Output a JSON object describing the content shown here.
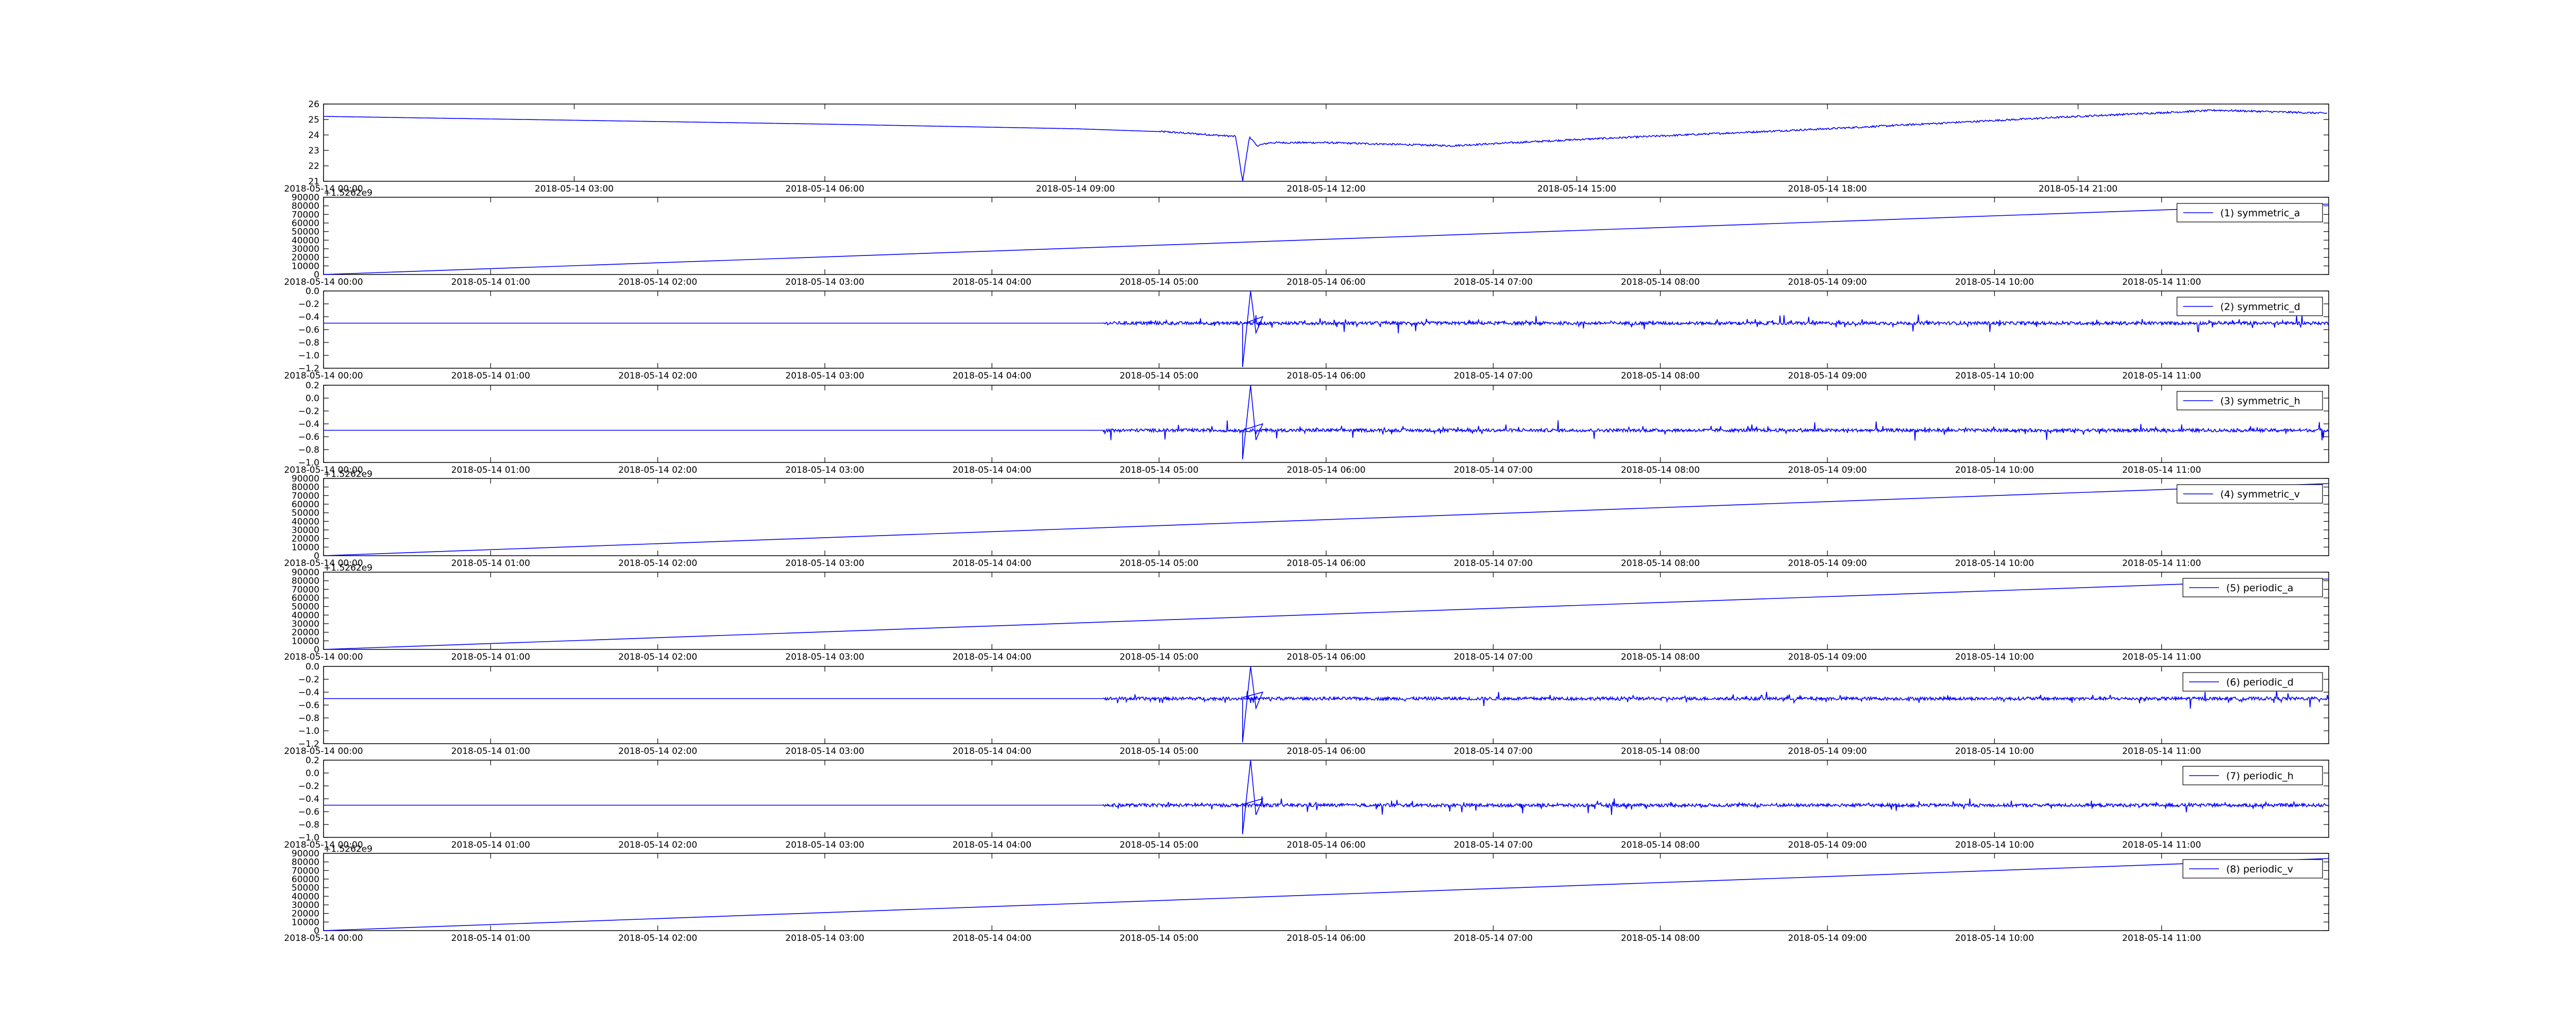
{
  "chart_data": [
    {
      "type": "line",
      "title": "",
      "ylabel": "",
      "xlabel": "",
      "series_color": "#0000ff",
      "ylim": [
        21,
        26
      ],
      "yticks": [
        21,
        22,
        23,
        24,
        25,
        26
      ],
      "xticks": [
        "2018-05-14 00:00",
        "2018-05-14 03:00",
        "2018-05-14 06:00",
        "2018-05-14 09:00",
        "2018-05-14 12:00",
        "2018-05-14 15:00",
        "2018-05-14 18:00",
        "2018-05-14 21:00"
      ],
      "xlim": [
        "2018-05-14 00:00",
        "2018-05-15 00:00"
      ],
      "offset_label": "",
      "legend": "",
      "shape": "temperature",
      "x": [
        "2018-05-14 00:00",
        "2018-05-14 03:00",
        "2018-05-14 06:00",
        "2018-05-14 09:00",
        "2018-05-14 10:05",
        "2018-05-14 10:55",
        "2018-05-14 11:00",
        "2018-05-14 11:05",
        "2018-05-14 11:10",
        "2018-05-14 11:20",
        "2018-05-14 12:00",
        "2018-05-14 13:30",
        "2018-05-14 15:00",
        "2018-05-14 18:00",
        "2018-05-14 21:00",
        "2018-05-14 22:40",
        "2018-05-14 23:59"
      ],
      "values": [
        25.2,
        24.95,
        24.7,
        24.4,
        24.2,
        23.9,
        21.0,
        23.9,
        23.3,
        23.5,
        23.5,
        23.3,
        23.7,
        24.4,
        25.2,
        25.6,
        25.4
      ]
    },
    {
      "type": "line",
      "title": "",
      "ylabel": "",
      "xlabel": "",
      "series_color": "#0000ff",
      "ylim": [
        0,
        90000
      ],
      "yticks": [
        0,
        10000,
        20000,
        30000,
        40000,
        50000,
        60000,
        70000,
        80000,
        90000
      ],
      "xticks": [
        "2018-05-14 00:00",
        "2018-05-14 01:00",
        "2018-05-14 02:00",
        "2018-05-14 03:00",
        "2018-05-14 04:00",
        "2018-05-14 05:00",
        "2018-05-14 06:00",
        "2018-05-14 07:00",
        "2018-05-14 08:00",
        "2018-05-14 09:00",
        "2018-05-14 10:00",
        "2018-05-14 11:00"
      ],
      "xlim": [
        "2018-05-14 00:00",
        "2018-05-14 12:00"
      ],
      "offset_label": "+1.5262e9",
      "legend": "(1) symmetric_a",
      "shape": "ramp",
      "x": [
        "2018-05-14 00:00",
        "2018-05-14 12:00"
      ],
      "values": [
        0,
        82000
      ]
    },
    {
      "type": "line",
      "title": "",
      "ylabel": "",
      "xlabel": "",
      "series_color": "#0000ff",
      "ylim": [
        -1.2,
        0.0
      ],
      "yticks": [
        "−1.2",
        "−1.0",
        "−0.8",
        "−0.6",
        "−0.4",
        "−0.2",
        "0.0"
      ],
      "xticks": [
        "2018-05-14 00:00",
        "2018-05-14 01:00",
        "2018-05-14 02:00",
        "2018-05-14 03:00",
        "2018-05-14 04:00",
        "2018-05-14 05:00",
        "2018-05-14 06:00",
        "2018-05-14 07:00",
        "2018-05-14 08:00",
        "2018-05-14 09:00",
        "2018-05-14 10:00",
        "2018-05-14 11:00"
      ],
      "xlim": [
        "2018-05-14 00:00",
        "2018-05-14 12:00"
      ],
      "offset_label": "",
      "legend": "(2) symmetric_d",
      "shape": "noise",
      "baseline": -0.5,
      "noise_start": "2018-05-14 04:40",
      "spike_time": "2018-05-14 05:30",
      "spike_min": -1.18,
      "spike_max": 0.0
    },
    {
      "type": "line",
      "title": "",
      "ylabel": "",
      "xlabel": "",
      "series_color": "#0000ff",
      "ylim": [
        -1.0,
        0.2
      ],
      "yticks": [
        "−1.0",
        "−0.8",
        "−0.6",
        "−0.4",
        "−0.2",
        "0.0",
        "0.2"
      ],
      "xticks": [
        "2018-05-14 00:00",
        "2018-05-14 01:00",
        "2018-05-14 02:00",
        "2018-05-14 03:00",
        "2018-05-14 04:00",
        "2018-05-14 05:00",
        "2018-05-14 06:00",
        "2018-05-14 07:00",
        "2018-05-14 08:00",
        "2018-05-14 09:00",
        "2018-05-14 10:00",
        "2018-05-14 11:00"
      ],
      "xlim": [
        "2018-05-14 00:00",
        "2018-05-14 12:00"
      ],
      "offset_label": "",
      "legend": "(3) symmetric_h",
      "shape": "noise",
      "baseline": -0.5,
      "noise_start": "2018-05-14 04:40",
      "spike_time": "2018-05-14 05:30",
      "spike_min": -0.95,
      "spike_max": 0.2
    },
    {
      "type": "line",
      "title": "",
      "ylabel": "",
      "xlabel": "",
      "series_color": "#0000ff",
      "ylim": [
        0,
        90000
      ],
      "yticks": [
        0,
        10000,
        20000,
        30000,
        40000,
        50000,
        60000,
        70000,
        80000,
        90000
      ],
      "xticks": [
        "2018-05-14 00:00",
        "2018-05-14 01:00",
        "2018-05-14 02:00",
        "2018-05-14 03:00",
        "2018-05-14 04:00",
        "2018-05-14 05:00",
        "2018-05-14 06:00",
        "2018-05-14 07:00",
        "2018-05-14 08:00",
        "2018-05-14 09:00",
        "2018-05-14 10:00",
        "2018-05-14 11:00"
      ],
      "xlim": [
        "2018-05-14 00:00",
        "2018-05-14 12:00"
      ],
      "offset_label": "+1.5262e9",
      "legend": "(4) symmetric_v",
      "shape": "ramp",
      "x": [
        "2018-05-14 00:00",
        "2018-05-14 12:00"
      ],
      "values": [
        0,
        84000
      ]
    },
    {
      "type": "line",
      "title": "",
      "ylabel": "",
      "xlabel": "",
      "series_color": "#0000ff",
      "ylim": [
        0,
        90000
      ],
      "yticks": [
        0,
        10000,
        20000,
        30000,
        40000,
        50000,
        60000,
        70000,
        80000,
        90000
      ],
      "xticks": [
        "2018-05-14 00:00",
        "2018-05-14 01:00",
        "2018-05-14 02:00",
        "2018-05-14 03:00",
        "2018-05-14 04:00",
        "2018-05-14 05:00",
        "2018-05-14 06:00",
        "2018-05-14 07:00",
        "2018-05-14 08:00",
        "2018-05-14 09:00",
        "2018-05-14 10:00",
        "2018-05-14 11:00"
      ],
      "xlim": [
        "2018-05-14 00:00",
        "2018-05-14 12:00"
      ],
      "offset_label": "+1.5262e9",
      "legend": "(5) periodic_a",
      "shape": "ramp",
      "x": [
        "2018-05-14 00:00",
        "2018-05-14 12:00"
      ],
      "values": [
        0,
        82000
      ]
    },
    {
      "type": "line",
      "title": "",
      "ylabel": "",
      "xlabel": "",
      "series_color": "#0000ff",
      "ylim": [
        -1.2,
        0.0
      ],
      "yticks": [
        "−1.2",
        "−1.0",
        "−0.8",
        "−0.6",
        "−0.4",
        "−0.2",
        "0.0"
      ],
      "xticks": [
        "2018-05-14 00:00",
        "2018-05-14 01:00",
        "2018-05-14 02:00",
        "2018-05-14 03:00",
        "2018-05-14 04:00",
        "2018-05-14 05:00",
        "2018-05-14 06:00",
        "2018-05-14 07:00",
        "2018-05-14 08:00",
        "2018-05-14 09:00",
        "2018-05-14 10:00",
        "2018-05-14 11:00"
      ],
      "xlim": [
        "2018-05-14 00:00",
        "2018-05-14 12:00"
      ],
      "offset_label": "",
      "legend": "(6) periodic_d",
      "shape": "noise",
      "baseline": -0.5,
      "noise_start": "2018-05-14 04:40",
      "spike_time": "2018-05-14 05:30",
      "spike_min": -1.18,
      "spike_max": 0.0
    },
    {
      "type": "line",
      "title": "",
      "ylabel": "",
      "xlabel": "",
      "series_color": "#0000ff",
      "ylim": [
        -1.0,
        0.2
      ],
      "yticks": [
        "−1.0",
        "−0.8",
        "−0.6",
        "−0.4",
        "−0.2",
        "0.0",
        "0.2"
      ],
      "xticks": [
        "2018-05-14 00:00",
        "2018-05-14 01:00",
        "2018-05-14 02:00",
        "2018-05-14 03:00",
        "2018-05-14 04:00",
        "2018-05-14 05:00",
        "2018-05-14 06:00",
        "2018-05-14 07:00",
        "2018-05-14 08:00",
        "2018-05-14 09:00",
        "2018-05-14 10:00",
        "2018-05-14 11:00"
      ],
      "xlim": [
        "2018-05-14 00:00",
        "2018-05-14 12:00"
      ],
      "offset_label": "",
      "legend": "(7) periodic_h",
      "shape": "noise",
      "baseline": -0.5,
      "noise_start": "2018-05-14 04:40",
      "spike_time": "2018-05-14 05:30",
      "spike_min": -0.95,
      "spike_max": 0.2
    },
    {
      "type": "line",
      "title": "",
      "ylabel": "",
      "xlabel": "",
      "series_color": "#0000ff",
      "ylim": [
        0,
        90000
      ],
      "yticks": [
        0,
        10000,
        20000,
        30000,
        40000,
        50000,
        60000,
        70000,
        80000,
        90000
      ],
      "xticks": [
        "2018-05-14 00:00",
        "2018-05-14 01:00",
        "2018-05-14 02:00",
        "2018-05-14 03:00",
        "2018-05-14 04:00",
        "2018-05-14 05:00",
        "2018-05-14 06:00",
        "2018-05-14 07:00",
        "2018-05-14 08:00",
        "2018-05-14 09:00",
        "2018-05-14 10:00",
        "2018-05-14 11:00"
      ],
      "xlim": [
        "2018-05-14 00:00",
        "2018-05-14 12:00"
      ],
      "offset_label": "+1.5262e9",
      "legend": "(8) periodic_v",
      "shape": "ramp",
      "x": [
        "2018-05-14 00:00",
        "2018-05-14 12:00"
      ],
      "values": [
        0,
        84000
      ]
    }
  ]
}
